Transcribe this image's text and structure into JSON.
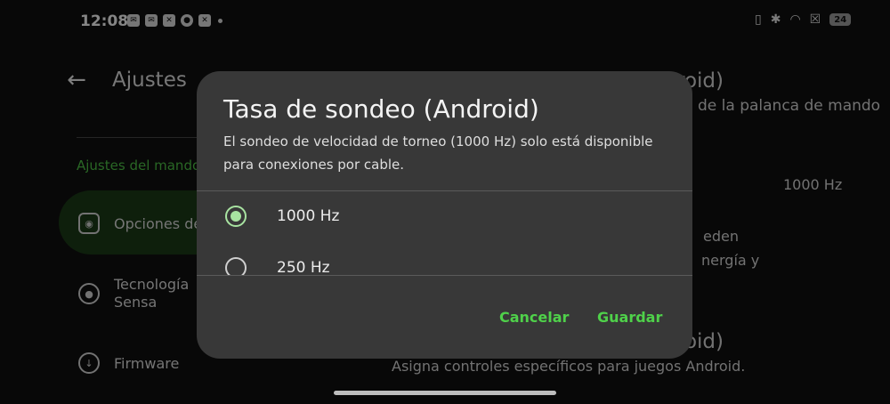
{
  "status_bar": {
    "time": "12:08",
    "notification_icons": [
      "mail-icon",
      "mail-icon",
      "muted-icon",
      "chat-icon",
      "muted-icon"
    ],
    "battery": "24"
  },
  "header": {
    "title": "Ajustes"
  },
  "sidebar": {
    "section_label": "Ajustes del mando",
    "items": [
      {
        "label": "Opciones de",
        "icon": "gamepad-icon",
        "selected": true
      },
      {
        "label": "Tecnología\nSensa",
        "icon": "sensa-icon"
      },
      {
        "label": "Firmware",
        "icon": "download-icon"
      }
    ]
  },
  "content": {
    "row1_title_fragment": "roid)",
    "row1_subtitle_fragment": "de la palanca de mando",
    "row2_value": "1000 Hz",
    "row3_fragment_1": "eden",
    "row3_fragment_2": "nergía y",
    "row4_title_fragment": "roid)",
    "row4_subtitle": "Asigna controles específicos para juegos Android."
  },
  "dialog": {
    "title": "Tasa de sondeo (Android)",
    "message": "El sondeo de velocidad de torneo (1000 Hz) solo está disponible para conexiones por cable.",
    "options": [
      {
        "label": "1000 Hz",
        "selected": true
      },
      {
        "label": "250 Hz",
        "selected": false
      }
    ],
    "cancel_label": "Cancelar",
    "save_label": "Guardar"
  },
  "colors": {
    "accent": "#4fd14a",
    "radio_selected": "#a8e3a1",
    "dialog_bg": "#383838"
  }
}
